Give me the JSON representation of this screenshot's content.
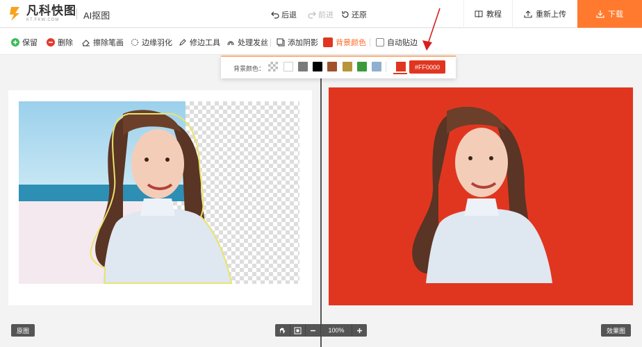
{
  "header": {
    "logo_name": "凡科快图",
    "logo_domain": "KT.FKW.COM",
    "app_title": "AI抠图",
    "undo_label": "后退",
    "redo_label": "前进",
    "restore_label": "还原",
    "tutorial_label": "教程",
    "reupload_label": "重新上传",
    "download_label": "下载"
  },
  "toolbar": {
    "save_label": "保留",
    "delete_label": "删除",
    "erase_label": "擦除笔画",
    "feather_label": "边缘羽化",
    "trim_label": "修边工具",
    "hair_label": "处理发丝",
    "shadow_label": "添加阴影",
    "bgcolor_label": "背景颜色",
    "autofit_label": "自动贴边"
  },
  "color_popup": {
    "label": "背景颜色：",
    "swatches": [
      "transparent",
      "#ffffff",
      "#7a7a7a",
      "#000000",
      "#a0522d",
      "#b8943a",
      "#3c9a3c",
      "#8fb0cf"
    ],
    "current_color": "#e03620",
    "current_hex": "#FF0000"
  },
  "canvas": {
    "original_label": "原图",
    "result_label": "效果图",
    "zoom_value": "100%"
  },
  "colors": {
    "accent": "#ff7a2e",
    "background_red": "#e03620"
  }
}
